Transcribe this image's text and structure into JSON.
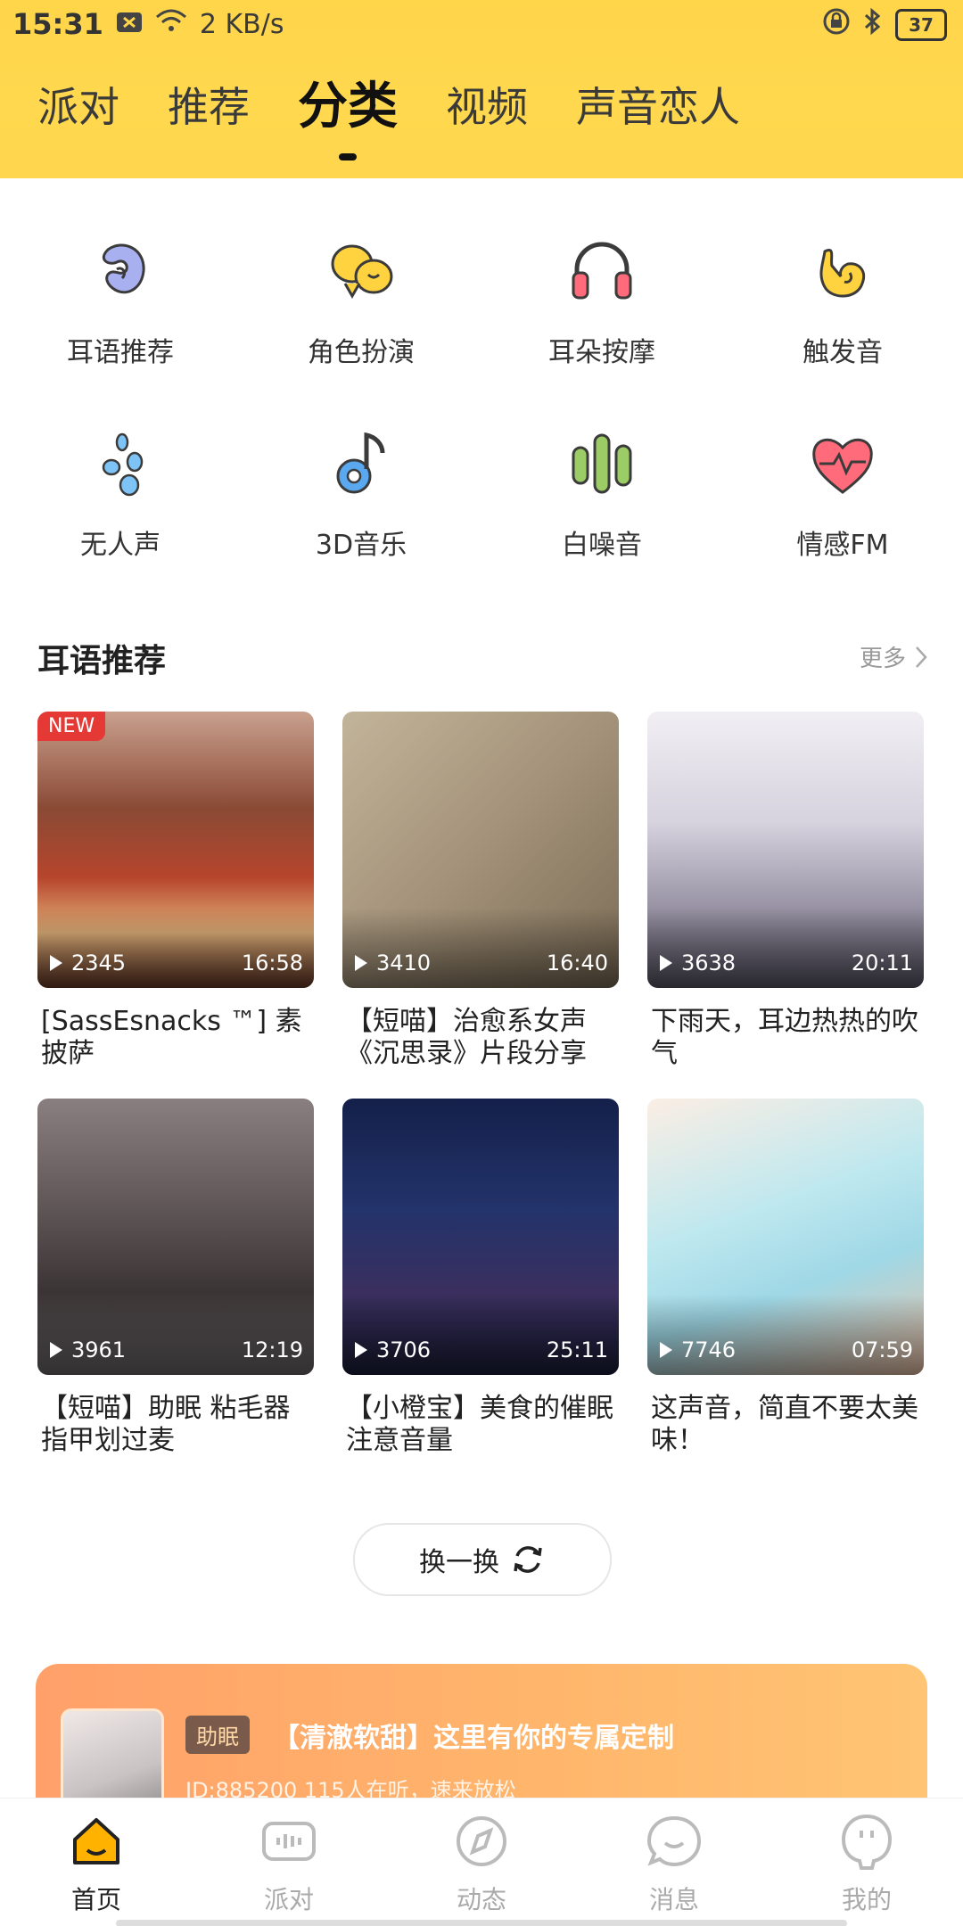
{
  "status_bar": {
    "time": "15:31",
    "speed": "2 KB/s",
    "battery": "37"
  },
  "tabs": [
    {
      "label": "派对"
    },
    {
      "label": "推荐"
    },
    {
      "label": "分类"
    },
    {
      "label": "视频"
    },
    {
      "label": "声音恋人"
    }
  ],
  "active_tab_index": 2,
  "categories": [
    {
      "label": "耳语推荐",
      "icon": "ear-whisper-icon",
      "color": "#a9b0f0"
    },
    {
      "label": "角色扮演",
      "icon": "role-play-icon",
      "color": "#ffd23f"
    },
    {
      "label": "耳朵按摩",
      "icon": "headphones-icon",
      "color": "#ff6b7a"
    },
    {
      "label": "触发音",
      "icon": "hand-gesture-icon",
      "color": "#ffd23f"
    },
    {
      "label": "无人声",
      "icon": "water-drops-icon",
      "color": "#7ec3f5"
    },
    {
      "label": "3D音乐",
      "icon": "music-note-icon",
      "color": "#5aa8f0"
    },
    {
      "label": "白噪音",
      "icon": "sound-bars-icon",
      "color": "#9ccc65"
    },
    {
      "label": "情感FM",
      "icon": "heart-pulse-icon",
      "color": "#ff6b7a"
    }
  ],
  "section": {
    "title": "耳语推荐",
    "more_label": "更多"
  },
  "cards": [
    {
      "title": "[SassEsnacks ™] 素 披萨",
      "plays": "2345",
      "duration": "16:58",
      "badge": "NEW",
      "thumb": "pizza-photo",
      "colors": [
        "#5a2c22",
        "#b04a2f"
      ]
    },
    {
      "title": "【短喵】治愈系女声《沉思录》片段分享",
      "plays": "3410",
      "duration": "16:40",
      "badge": "",
      "thumb": "book-cover",
      "colors": [
        "#b6a58a",
        "#8a7a62"
      ]
    },
    {
      "title": "下雨天，耳边热热的吹气",
      "plays": "3638",
      "duration": "20:11",
      "badge": "",
      "thumb": "anime-maid",
      "colors": [
        "#e9e6ee",
        "#b8b3c3"
      ]
    },
    {
      "title": "【短喵】助眠 粘毛器 指甲划过麦",
      "plays": "3961",
      "duration": "12:19",
      "badge": "",
      "thumb": "night-sea",
      "colors": [
        "#6b6060",
        "#2e2a2b"
      ]
    },
    {
      "title": "【小橙宝】美食的催眠 注意音量",
      "plays": "3706",
      "duration": "25:11",
      "badge": "",
      "thumb": "anime-girl-night",
      "colors": [
        "#1d2c5e",
        "#3a2a55"
      ]
    },
    {
      "title": "这声音，简直不要太美味！",
      "plays": "7746",
      "duration": "07:59",
      "badge": "",
      "thumb": "anime-catgirl",
      "colors": [
        "#bfe8ef",
        "#f2c3a2"
      ]
    }
  ],
  "refresh_label": "换一换",
  "banner": {
    "tag": "助眠",
    "title": "【清澈软甜】这里有你的专属定制",
    "subtitle": "ID:885200  115人在听，速来放松"
  },
  "bottom_nav": [
    {
      "label": "首页",
      "icon": "home-icon"
    },
    {
      "label": "派对",
      "icon": "party-icon"
    },
    {
      "label": "动态",
      "icon": "compass-icon"
    },
    {
      "label": "消息",
      "icon": "message-icon"
    },
    {
      "label": "我的",
      "icon": "profile-icon"
    }
  ],
  "colors": {
    "header": "#ffd54a",
    "banner": "#ffa06a",
    "accent": "#ffb300"
  }
}
